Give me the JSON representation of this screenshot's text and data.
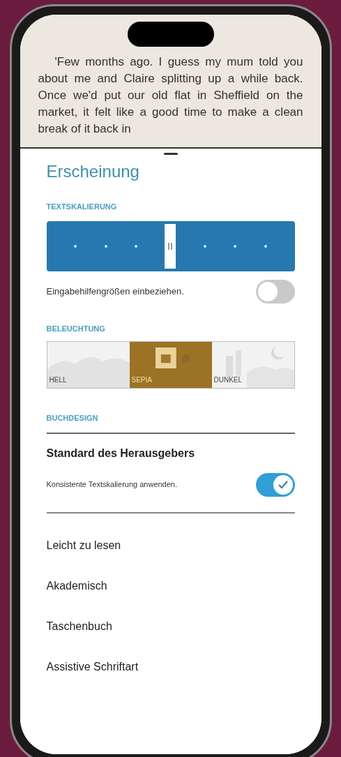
{
  "book_text": "'Few months ago. I guess my mum told you about me and Claire splitting up a while back. Once we'd put our old flat in Sheffield on the market, it felt like a good time to make a clean break of it back in",
  "sheet": {
    "title": "Erscheinung",
    "text_scaling": {
      "heading": "TEXTSKALIERUNG",
      "level": 0.5,
      "accessibility_label": "Eingabehilfengrößen einbeziehen.",
      "accessibility_on": false
    },
    "lighting": {
      "heading": "BELEUCHTUNG",
      "options": [
        {
          "label": "HELL",
          "kind": "light",
          "selected": false
        },
        {
          "label": "SEPIA",
          "kind": "sepia",
          "selected": true
        },
        {
          "label": "DUNKEL",
          "kind": "dark",
          "selected": false
        }
      ]
    },
    "book_design": {
      "heading": "BUCHDESIGN",
      "options": [
        {
          "label": "Standard des Herausgebers",
          "selected": true,
          "toggle_label": "Konsistente Textskalierung anwenden.",
          "toggle_on": true
        },
        {
          "label": "Leicht zu lesen",
          "selected": false
        },
        {
          "label": "Akademisch",
          "selected": false
        },
        {
          "label": "Taschenbuch",
          "selected": false
        },
        {
          "label": "Assistive Schriftart",
          "selected": false
        }
      ]
    }
  }
}
